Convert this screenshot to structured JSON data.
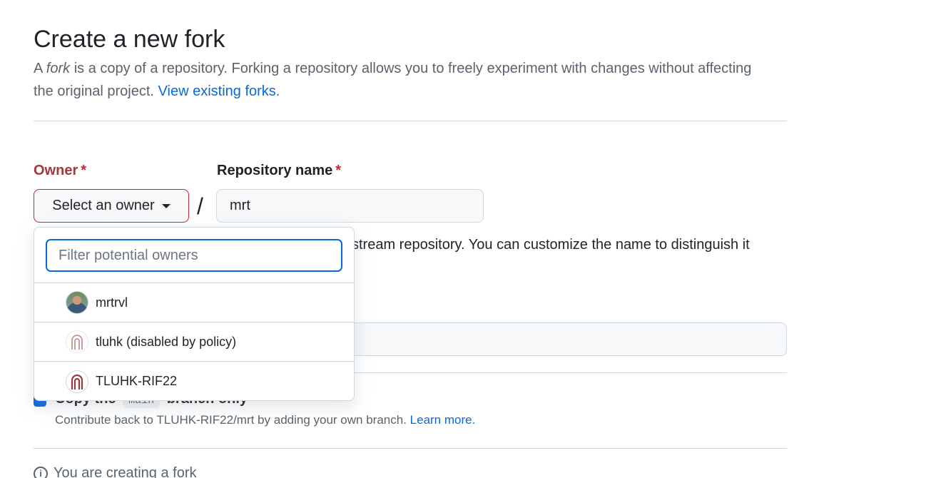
{
  "header": {
    "title": "Create a new fork",
    "subtitle_part1": "A ",
    "subtitle_em": "fork",
    "subtitle_part2": " is a copy of a repository. Forking a repository allows you to freely experiment with changes without affecting the original project. ",
    "view_forks_link": "View existing forks."
  },
  "form": {
    "owner_label": "Owner",
    "repo_label": "Repository name",
    "required_mark": "*",
    "owner_button": "Select an owner",
    "slash": "/",
    "repo_value": "mrt",
    "name_help_visible": "stream repository. You can customize the name to distinguish it"
  },
  "dropdown": {
    "filter_placeholder": "Filter potential owners",
    "owners": [
      {
        "name": "mrtrvl",
        "avatar": "user-photo-avatar"
      },
      {
        "name": "tluhk (disabled by policy)",
        "avatar": "org-arch-logo"
      },
      {
        "name": "TLUHK-RIF22",
        "avatar": "org-arch-logo"
      }
    ]
  },
  "copy_branch": {
    "label_part1": "Copy the",
    "branch": "main",
    "label_part2": "branch only",
    "help": "Contribute back to TLUHK-RIF22/mrt by adding your own branch.",
    "learn_more": "Learn more."
  },
  "info": {
    "text": "You are creating a fork"
  },
  "colors": {
    "accent": "#0969da",
    "danger": "#cf222e",
    "owner_label": "#a0393a",
    "org_logo": "#9a3b3f"
  }
}
